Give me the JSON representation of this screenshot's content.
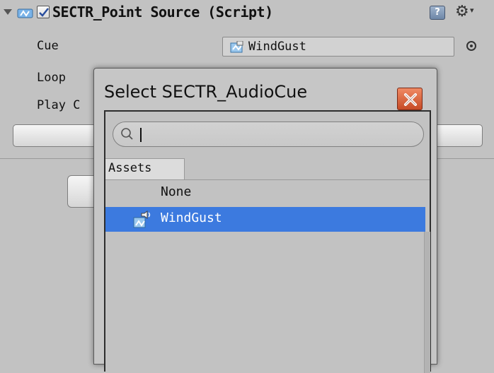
{
  "inspector": {
    "component_title": "SECTR_Point Source (Script)",
    "help_icon_glyph": "?",
    "properties": {
      "cue_label": "Cue",
      "cue_value": "WindGust",
      "loop_label": "Loop",
      "play_label": "Play C"
    }
  },
  "popup": {
    "title": "Select SECTR_AudioCue",
    "search": {
      "value": "",
      "placeholder": ""
    },
    "tabs": [
      {
        "label": "Assets",
        "active": true
      }
    ],
    "items": [
      {
        "label": "None",
        "selected": false,
        "icon": "none"
      },
      {
        "label": "WindGust",
        "selected": true,
        "icon": "audio-cue-icon"
      }
    ]
  },
  "colors": {
    "selection": "#3c7adf",
    "close_button": "#d9603a",
    "panel_bg": "#c2c2c2"
  }
}
